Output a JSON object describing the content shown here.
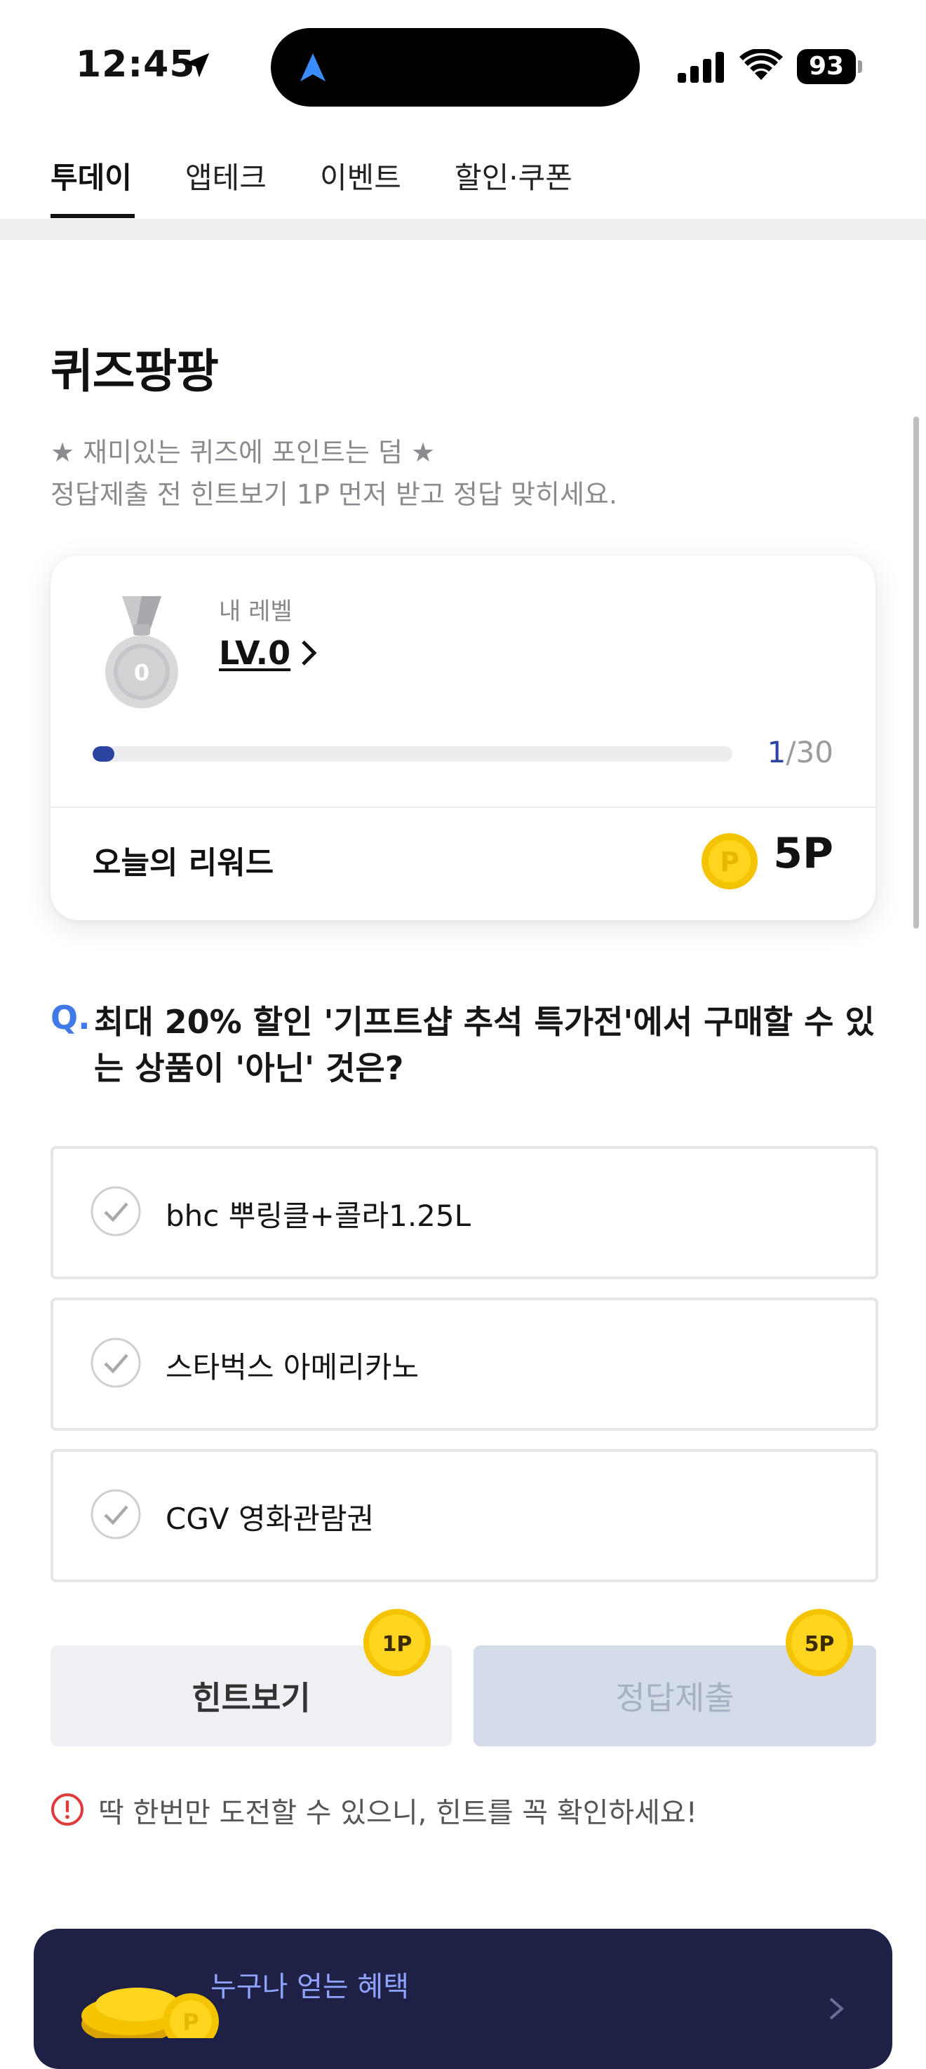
{
  "status_bar": {
    "time": "12:45",
    "battery": "93",
    "icons": [
      "location-arrow-icon",
      "navigation-icon",
      "signal-icon",
      "wifi-icon",
      "battery-icon"
    ]
  },
  "tabs": [
    {
      "label": "투데이",
      "active": true
    },
    {
      "label": "앱테크",
      "active": false
    },
    {
      "label": "이벤트",
      "active": false
    },
    {
      "label": "할인·쿠폰",
      "active": false
    }
  ],
  "page": {
    "title": "퀴즈팡팡",
    "subtitle_line1": "★ 재미있는 퀴즈에 포인트는 덤 ★",
    "subtitle_line2": "정답제출 전 힌트보기 1P 먼저 받고 정답 맞히세요."
  },
  "level_card": {
    "medal_number": "0",
    "label": "내 레벨",
    "value": "LV.0",
    "progress_current": "1",
    "progress_total": "/30",
    "progress_fraction": 0.0333,
    "reward_label": "오늘의 리워드",
    "coin_symbol": "P",
    "reward_value": "5P"
  },
  "quiz": {
    "q_mark": "Q.",
    "question": "최대 20% 할인 '기프트샵 추석 특가전'에서 구매할 수 있는 상품이 '아닌' 것은?",
    "options": [
      {
        "label": "bhc 뿌링클+콜라1.25L"
      },
      {
        "label": "스타벅스 아메리카노"
      },
      {
        "label": "CGV 영화관람권"
      }
    ]
  },
  "buttons": {
    "hint_label": "힌트보기",
    "hint_badge": "1P",
    "submit_label": "정답제출",
    "submit_badge": "5P"
  },
  "warning": "딱 한번만 도전할 수 있으니, 힌트를 꼭 확인하세요!",
  "banner": {
    "text": "누구나 얻는 혜택",
    "coin_symbol": "P"
  },
  "colors": {
    "accent_blue": "#3f7ae6",
    "progress_blue": "#2b44a0",
    "banner_bg": "#1e2046",
    "coin_gold": "#f5c400",
    "warning_red": "#e03a3a"
  }
}
